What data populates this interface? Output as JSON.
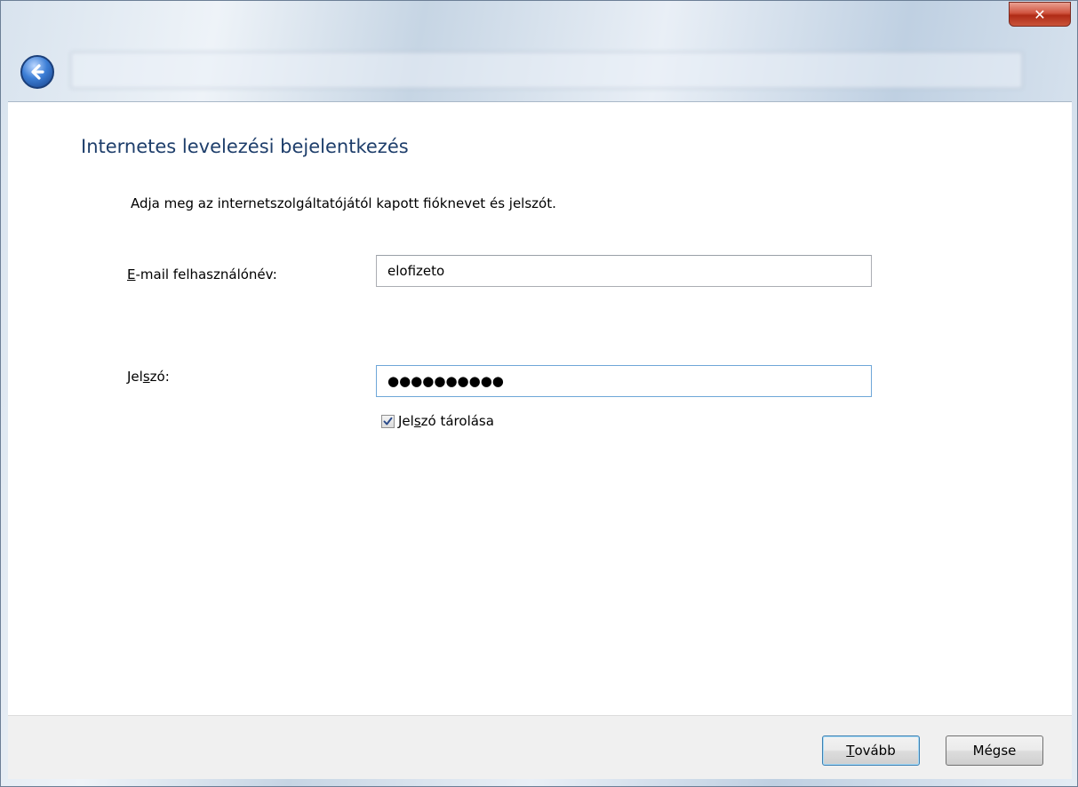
{
  "window": {
    "close_glyph": "✕"
  },
  "page": {
    "title": "Internetes levelezési bejelentkezés",
    "instructions": "Adja meg az internetszolgáltatójától kapott fióknevet és jelszót."
  },
  "form": {
    "email_label_mnemonic": "E",
    "email_label_rest": "-mail felhasználónév:",
    "email_value": "elofizeto",
    "password_label_pre": "Jel",
    "password_label_mnemonic": "s",
    "password_label_post": "zó:",
    "password_masked": "●●●●●●●●●●",
    "remember_label_pre": "Jel",
    "remember_label_mnemonic": "s",
    "remember_label_post": "zó tárolása",
    "remember_checked": true
  },
  "buttons": {
    "next_mnemonic": "T",
    "next_rest": "ovább",
    "cancel": "Mégse"
  }
}
